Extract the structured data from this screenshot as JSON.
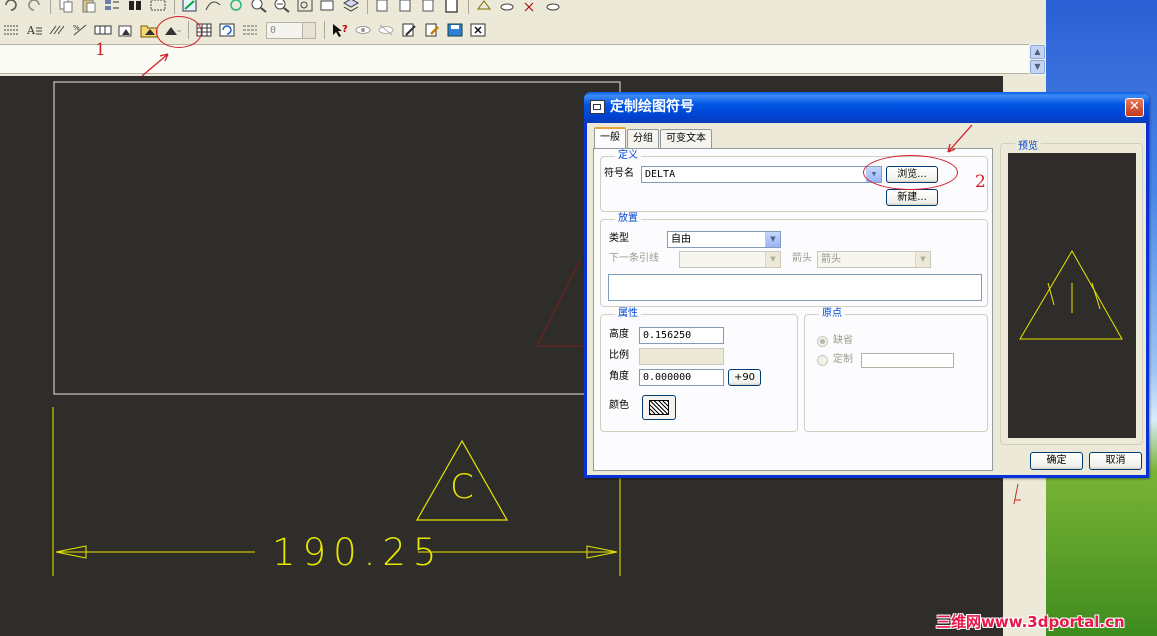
{
  "toolbar": {
    "spin_value": "0"
  },
  "annotations": {
    "num1": "1",
    "num2": "2"
  },
  "drawing": {
    "dimension_text": "190.25",
    "symbol_letter": "C",
    "line_color": "#e6e600",
    "background_color": "#2f2d29"
  },
  "dialog": {
    "title": "定制绘图符号",
    "close_label": "✕",
    "tabs": [
      {
        "label": "一般",
        "active": true
      },
      {
        "label": "分组",
        "active": false
      },
      {
        "label": "可变文本",
        "active": false
      }
    ],
    "definition": {
      "title": "定义",
      "symbol_name_label": "符号名",
      "symbol_name_value": "DELTA",
      "browse_label": "浏览...",
      "new_label": "新建..."
    },
    "placement": {
      "title": "放置",
      "type_label": "类型",
      "type_value": "自由",
      "next_leader_label": "下一条引线",
      "next_leader_value": "",
      "arrow_label": "箭头",
      "arrow_value": "箭头"
    },
    "properties": {
      "title": "属性",
      "height_label": "高度",
      "height_value": "0.156250",
      "scale_label": "比例",
      "scale_value": "",
      "angle_label": "角度",
      "angle_value": "0.000000",
      "rotate_label": "+90",
      "color_label": "颜色"
    },
    "origin": {
      "title": "原点",
      "default_label": "缺省",
      "custom_label": "定制",
      "custom_value": ""
    },
    "preview": {
      "title": "预览"
    },
    "ok_label": "确定",
    "cancel_label": "取消"
  },
  "watermark": "三维网www.3dportal.cn",
  "colors": {
    "accent_red": "#d0202a",
    "xp_blue": "#0831d9",
    "group_title": "#0046d5"
  }
}
